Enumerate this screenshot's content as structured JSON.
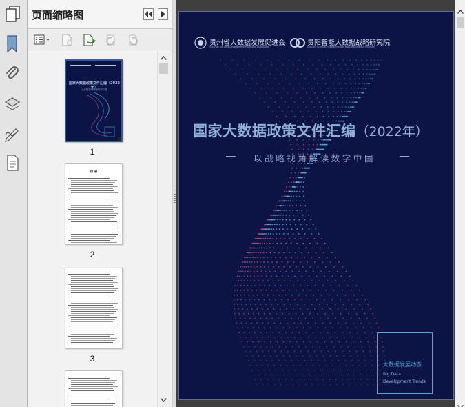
{
  "panel": {
    "title": "页面缩略图"
  },
  "thumbnails": [
    {
      "label": "1"
    },
    {
      "label": "2"
    },
    {
      "label": "3"
    }
  ],
  "cover": {
    "org1_cn": "贵州省大数据发展促进会",
    "org1_en": "GuiZhou Big Data Development Promotion Association",
    "org2_cn": "贵阳智能大数据战略研究院",
    "org2_en": "Guiyang Artificial Intelligence and Big Data Strategy Institute",
    "title_main": "国家大数据政策文件汇编",
    "title_year": "（2022年）",
    "subtitle": "以战略视角解读数字中国",
    "box_cn": "大数据发展动态",
    "box_en1": "Big Data",
    "box_en2": "Development Trends"
  },
  "thumb_cover": {
    "title": "国家大数据政策文件汇编（2022年）",
    "subtitle": "以战略视角解读数字中国"
  },
  "thumb_toc": {
    "heading": "目 录"
  },
  "colors": {
    "cover_bg": "#0c1446",
    "title_text": "#8fb0d8",
    "accent": "#4aa8d8"
  }
}
